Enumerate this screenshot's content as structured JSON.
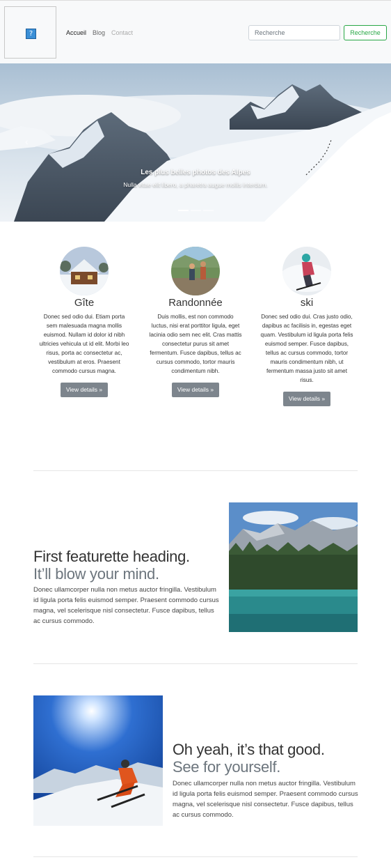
{
  "navbar": {
    "links": [
      {
        "label": "Accueil"
      },
      {
        "label": "Blog"
      },
      {
        "label": "Contact"
      }
    ],
    "search_placeholder": "Recherche",
    "search_button": "Recherche"
  },
  "carousel": {
    "caption_title": "Les plus belles photos des Alpes",
    "caption_text": "Nulla vitae elit libero, a pharetra augue mollis interdum.",
    "prev_icon": "chevron-left",
    "next_icon": "chevron-right"
  },
  "columns": [
    {
      "title": "Gîte",
      "text": "Donec sed odio dui. Etiam porta sem malesuada magna mollis euismod. Nullam id dolor id nibh ultricies vehicula ut id elit. Morbi leo risus, porta ac consectetur ac, vestibulum at eros. Praesent commodo cursus magna.",
      "button": "View details »"
    },
    {
      "title": "Randonnée",
      "text": "Duis mollis, est non commodo luctus, nisi erat porttitor ligula, eget lacinia odio sem nec elit. Cras mattis consectetur purus sit amet fermentum. Fusce dapibus, tellus ac cursus commodo, tortor mauris condimentum nibh.",
      "button": "View details »"
    },
    {
      "title": "ski",
      "text": "Donec sed odio dui. Cras justo odio, dapibus ac facilisis in, egestas eget quam. Vestibulum id ligula porta felis euismod semper. Fusce dapibus, tellus ac cursus commodo, tortor mauris condimentum nibh, ut fermentum massa justo sit amet risus.",
      "button": "View details »"
    }
  ],
  "featurettes": [
    {
      "heading": "First featurette heading.",
      "subheading": "It’ll blow your mind.",
      "text": "Donec ullamcorper nulla non metus auctor fringilla. Vestibulum id ligula porta felis euismod semper. Praesent commodo cursus magna, vel scelerisque nisl consectetur. Fusce dapibus, tellus ac cursus commodo."
    },
    {
      "heading": "Oh yeah, it’s that good.",
      "subheading": "See for yourself.",
      "text": "Donec ullamcorper nulla non metus auctor fringilla. Vestibulum id ligula porta felis euismod semper. Praesent commodo cursus magna, vel scelerisque nisl consectetur. Fusce dapibus, tellus ac cursus commodo."
    }
  ],
  "colors": {
    "navbar_bg": "#f8f9fa",
    "success": "#28a745",
    "button_gray": "#7d858d",
    "muted_text": "#6c757d"
  }
}
